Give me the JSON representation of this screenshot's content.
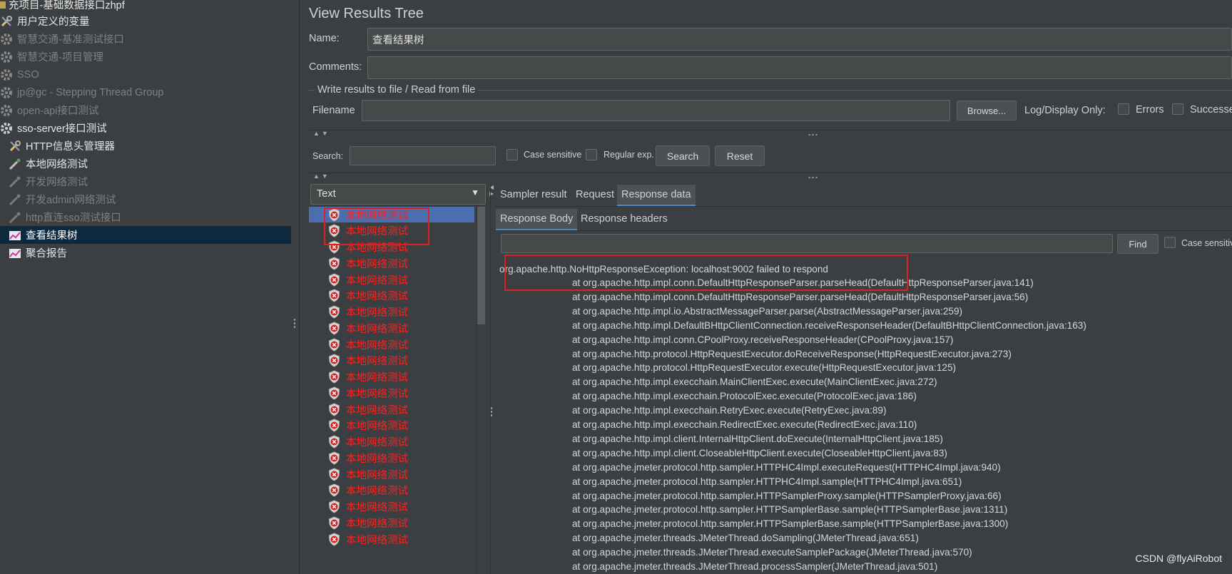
{
  "tree": {
    "items": [
      {
        "label": "充项目-基础数据接口zhpf",
        "state": "enabled",
        "icon": "folder-icon"
      },
      {
        "label": "用户定义的变量",
        "state": "enabled",
        "icon": "wrench-icon"
      },
      {
        "label": "智慧交通-基准测试接口",
        "state": "disabled",
        "icon": "gear-icon"
      },
      {
        "label": "智慧交通-项目管理",
        "state": "disabled",
        "icon": "gear-icon"
      },
      {
        "label": "SSO",
        "state": "disabled",
        "icon": "gear-icon"
      },
      {
        "label": "jp@gc - Stepping Thread Group",
        "state": "disabled",
        "icon": "gear-icon"
      },
      {
        "label": "open-api接口测试",
        "state": "disabled",
        "icon": "gear-icon"
      },
      {
        "label": "sso-server接口测试",
        "state": "enabled",
        "icon": "gear-icon"
      },
      {
        "label": "HTTP信息头管理器",
        "state": "enabled",
        "icon": "wrench-icon"
      },
      {
        "label": "本地网络测试",
        "state": "enabled",
        "icon": "pipette-icon"
      },
      {
        "label": "开发网络测试",
        "state": "disabled",
        "icon": "pipette-icon"
      },
      {
        "label": "开发admin网络测试",
        "state": "disabled",
        "icon": "pipette-icon"
      },
      {
        "label": "http直连sso测试接口",
        "state": "disabled",
        "icon": "pipette-icon"
      },
      {
        "label": "查看结果树",
        "state": "selected",
        "icon": "chart-icon"
      },
      {
        "label": "聚合报告",
        "state": "enabled",
        "icon": "chart-icon"
      }
    ]
  },
  "panel": {
    "title": "View Results Tree",
    "name_label": "Name:",
    "name_value": "查看结果树",
    "comments_label": "Comments:",
    "comments_value": "",
    "file_group_label": "Write results to file / Read from file",
    "filename_label": "Filename",
    "filename_value": "",
    "browse_label": "Browse...",
    "log_display_label": "Log/Display Only:",
    "errors_label": "Errors",
    "successes_label": "Successes",
    "search_label": "Search:",
    "search_value": "",
    "case_sensitive_label": "Case sensitive",
    "regex_label": "Regular exp.",
    "search_button": "Search",
    "reset_button": "Reset"
  },
  "renderer": {
    "selected": "Text"
  },
  "results": {
    "label": "本地网络测试",
    "count": 21,
    "selected_index": 0,
    "status_icon": "error-shield-icon"
  },
  "tabs": {
    "main": [
      "Sampler result",
      "Request",
      "Response data"
    ],
    "main_active": 2,
    "sub": [
      "Response Body",
      "Response headers"
    ],
    "sub_active": 0
  },
  "find": {
    "value": "",
    "button": "Find",
    "case_label": "Case sensitive"
  },
  "response": {
    "first_line": "org.apache.http.NoHttpResponseException: localhost:9002 failed to respond",
    "stack": [
      "at org.apache.http.impl.conn.DefaultHttpResponseParser.parseHead(DefaultHttpResponseParser.java:141)",
      "at org.apache.http.impl.conn.DefaultHttpResponseParser.parseHead(DefaultHttpResponseParser.java:56)",
      "at org.apache.http.impl.io.AbstractMessageParser.parse(AbstractMessageParser.java:259)",
      "at org.apache.http.impl.DefaultBHttpClientConnection.receiveResponseHeader(DefaultBHttpClientConnection.java:163)",
      "at org.apache.http.impl.conn.CPoolProxy.receiveResponseHeader(CPoolProxy.java:157)",
      "at org.apache.http.protocol.HttpRequestExecutor.doReceiveResponse(HttpRequestExecutor.java:273)",
      "at org.apache.http.protocol.HttpRequestExecutor.execute(HttpRequestExecutor.java:125)",
      "at org.apache.http.impl.execchain.MainClientExec.execute(MainClientExec.java:272)",
      "at org.apache.http.impl.execchain.ProtocolExec.execute(ProtocolExec.java:186)",
      "at org.apache.http.impl.execchain.RetryExec.execute(RetryExec.java:89)",
      "at org.apache.http.impl.execchain.RedirectExec.execute(RedirectExec.java:110)",
      "at org.apache.http.impl.client.InternalHttpClient.doExecute(InternalHttpClient.java:185)",
      "at org.apache.http.impl.client.CloseableHttpClient.execute(CloseableHttpClient.java:83)",
      "at org.apache.jmeter.protocol.http.sampler.HTTPHC4Impl.executeRequest(HTTPHC4Impl.java:940)",
      "at org.apache.jmeter.protocol.http.sampler.HTTPHC4Impl.sample(HTTPHC4Impl.java:651)",
      "at org.apache.jmeter.protocol.http.sampler.HTTPSamplerProxy.sample(HTTPSamplerProxy.java:66)",
      "at org.apache.jmeter.protocol.http.sampler.HTTPSamplerBase.sample(HTTPSamplerBase.java:1311)",
      "at org.apache.jmeter.protocol.http.sampler.HTTPSamplerBase.sample(HTTPSamplerBase.java:1300)",
      "at org.apache.jmeter.threads.JMeterThread.doSampling(JMeterThread.java:651)",
      "at org.apache.jmeter.threads.JMeterThread.executeSamplePackage(JMeterThread.java:570)",
      "at org.apache.jmeter.threads.JMeterThread.processSampler(JMeterThread.java:501)"
    ]
  },
  "watermark": "CSDN @flyAiRobot",
  "colors": {
    "background": "#3c3f41",
    "error_text": "#ff2020",
    "highlight_box": "#e02020",
    "selected_row": "#4b6eaf",
    "selected_tree": "#0d293e"
  }
}
